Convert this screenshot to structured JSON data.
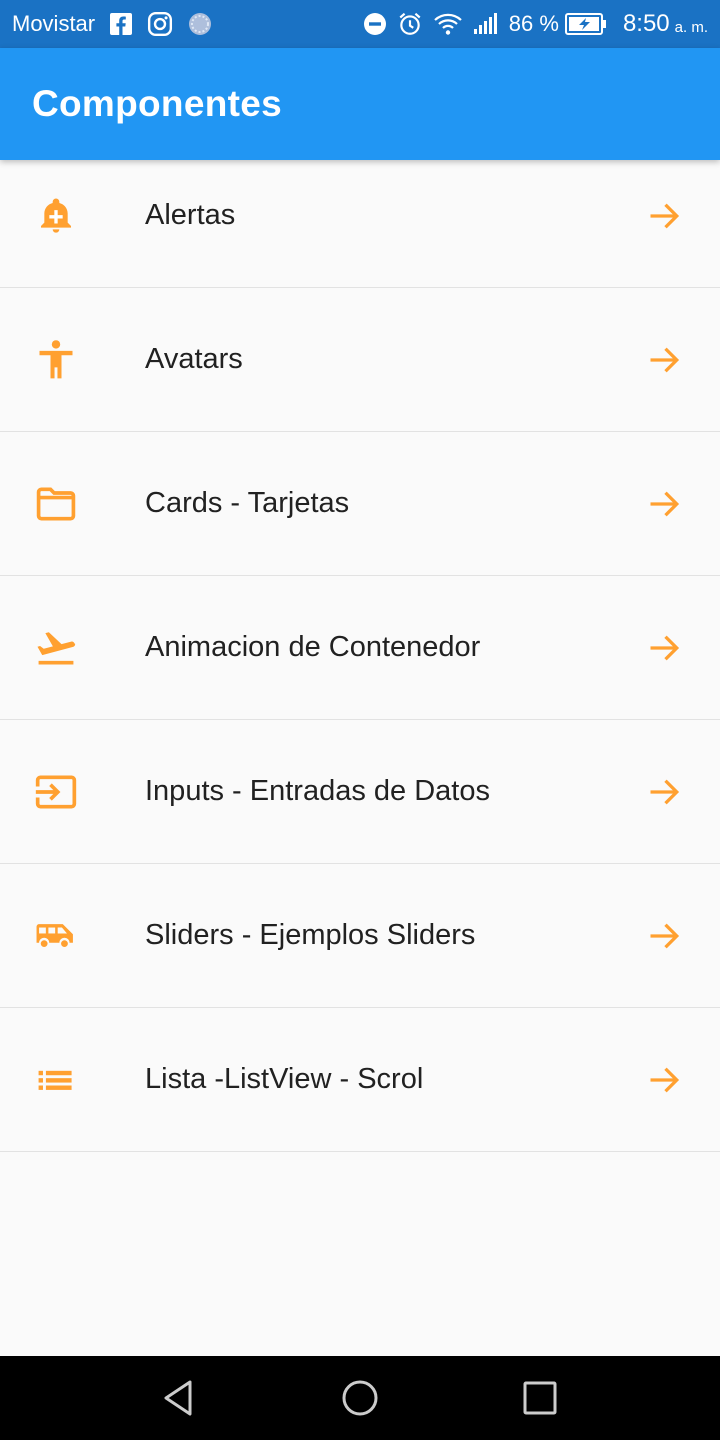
{
  "status_bar": {
    "carrier": "Movistar",
    "battery_percent": "86 %",
    "time": "8:50",
    "time_suffix": "a. m.",
    "icons_left": [
      "facebook-icon",
      "instagram-icon",
      "sync-dots-icon"
    ],
    "icons_right": [
      "do-not-disturb-icon",
      "alarm-icon",
      "wifi-icon",
      "signal-icon",
      "battery-charging-icon"
    ]
  },
  "app_bar": {
    "title": "Componentes",
    "color": "#2196f3"
  },
  "accent_color": "#ffa030",
  "menu": {
    "items": [
      {
        "label": "Alertas",
        "icon": "add-alert-icon"
      },
      {
        "label": "Avatars",
        "icon": "accessibility-icon"
      },
      {
        "label": "Cards - Tarjetas",
        "icon": "folder-icon"
      },
      {
        "label": "Animacion de Contenedor",
        "icon": "flight-takeoff-icon"
      },
      {
        "label": "Inputs - Entradas de Datos",
        "icon": "input-icon"
      },
      {
        "label": "Sliders - Ejemplos Sliders",
        "icon": "airport-shuttle-icon"
      },
      {
        "label": "Lista -ListView - Scrol",
        "icon": "list-icon"
      }
    ],
    "trailing_icon": "arrow-forward-icon"
  },
  "nav_bar": {
    "buttons": [
      "back-icon",
      "home-icon",
      "recents-icon"
    ]
  }
}
